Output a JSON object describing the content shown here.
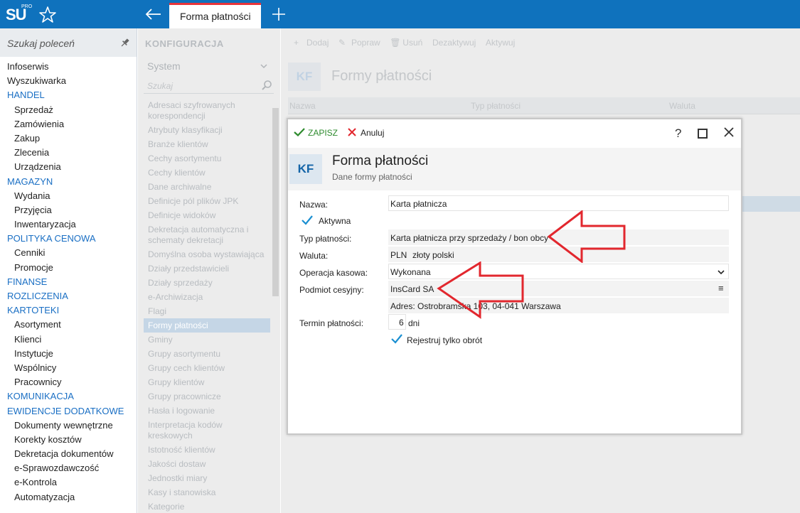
{
  "app": {
    "logo_text": "SU",
    "logo_badge": "PRO",
    "active_tab": "Forma płatności"
  },
  "leftnav": {
    "search_placeholder": "Szukaj poleceń",
    "items": [
      {
        "label": "Infoserwis",
        "kind": "top"
      },
      {
        "label": "Wyszukiwarka",
        "kind": "top"
      },
      {
        "label": "HANDEL",
        "kind": "section"
      },
      {
        "label": "Sprzedaż",
        "kind": "sub"
      },
      {
        "label": "Zamówienia",
        "kind": "sub"
      },
      {
        "label": "Zakup",
        "kind": "sub"
      },
      {
        "label": "Zlecenia",
        "kind": "sub"
      },
      {
        "label": "Urządzenia",
        "kind": "sub"
      },
      {
        "label": "MAGAZYN",
        "kind": "section"
      },
      {
        "label": "Wydania",
        "kind": "sub"
      },
      {
        "label": "Przyjęcia",
        "kind": "sub"
      },
      {
        "label": "Inwentaryzacja",
        "kind": "sub"
      },
      {
        "label": "POLITYKA CENOWA",
        "kind": "section"
      },
      {
        "label": "Cenniki",
        "kind": "sub"
      },
      {
        "label": "Promocje",
        "kind": "sub"
      },
      {
        "label": "FINANSE",
        "kind": "section"
      },
      {
        "label": "ROZLICZENIA",
        "kind": "section"
      },
      {
        "label": "KARTOTEKI",
        "kind": "section"
      },
      {
        "label": "Asortyment",
        "kind": "sub"
      },
      {
        "label": "Klienci",
        "kind": "sub"
      },
      {
        "label": "Instytucje",
        "kind": "sub"
      },
      {
        "label": "Wspólnicy",
        "kind": "sub"
      },
      {
        "label": "Pracownicy",
        "kind": "sub"
      },
      {
        "label": "KOMUNIKACJA",
        "kind": "section"
      },
      {
        "label": "EWIDENCJE DODATKOWE",
        "kind": "section"
      },
      {
        "label": "Dokumenty wewnętrzne",
        "kind": "sub"
      },
      {
        "label": "Korekty kosztów",
        "kind": "sub"
      },
      {
        "label": "Dekretacja dokumentów",
        "kind": "sub"
      },
      {
        "label": "e-Sprawozdawczość",
        "kind": "sub"
      },
      {
        "label": "e-Kontrola",
        "kind": "sub"
      },
      {
        "label": "Automatyzacja",
        "kind": "sub"
      }
    ]
  },
  "config_panel": {
    "header": "KONFIGURACJA",
    "select_value": "System",
    "search_placeholder": "Szukaj",
    "items": [
      "Adresaci szyfrowanych korespondencji",
      "Atrybuty klasyfikacji",
      "Branże klientów",
      "Cechy asortymentu",
      "Cechy klientów",
      "Dane archiwalne",
      "Definicje pól plików JPK",
      "Definicje widoków",
      "Dekretacja automatyczna i schematy dekretacji",
      "Domyślna osoba wystawiająca",
      "Działy przedstawicieli",
      "Działy sprzedaży",
      "e-Archiwizacja",
      "Flagi",
      "Formy płatności",
      "Gminy",
      "Grupy asortymentu",
      "Grupy cech klientów",
      "Grupy klientów",
      "Grupy pracownicze",
      "Hasła i logowanie",
      "Interpretacja kodów kreskowych",
      "Istotność klientów",
      "Jakości dostaw",
      "Jednostki miary",
      "Kasy i stanowiska",
      "Kategorie"
    ],
    "selected_index": 14
  },
  "main": {
    "toolbar": [
      "Dodaj",
      "Popraw",
      "Usuń",
      "Dezaktywuj",
      "Aktywuj"
    ],
    "badge": "KF",
    "title": "Formy płatności",
    "columns": [
      "Nazwa",
      "Typ płatności",
      "Waluta"
    ]
  },
  "dialog": {
    "save_label": "ZAPISZ",
    "cancel_label": "Anuluj",
    "help_label": "?",
    "badge": "KF",
    "title": "Forma płatności",
    "subtitle": "Dane formy płatności",
    "fields": {
      "name_label": "Nazwa:",
      "name_value": "Karta płatnicza",
      "active_label": "Aktywna",
      "active_checked": true,
      "type_label": "Typ płatności:",
      "type_value": "Karta płatnicza przy sprzedaży / bon obcy",
      "currency_label": "Waluta:",
      "currency_code": "PLN",
      "currency_name": "złoty polski",
      "cash_op_label": "Operacja kasowa:",
      "cash_op_value": "Wykonana",
      "assignee_label": "Podmiot cesyjny:",
      "assignee_value": "InsCard SA",
      "address_label": "Adres:",
      "address_value": "Ostrobramska 103, 04-041 Warszawa",
      "term_label": "Termin płatności:",
      "term_value": "6",
      "term_unit": "dni",
      "turnover_label": "Rejestruj tylko obrót",
      "turnover_checked": true
    }
  },
  "colors": {
    "topbar": "#0f72bd",
    "tab_accent": "#e8343a",
    "section_blue": "#1a6fc4",
    "annotation_red": "#e2272e"
  }
}
